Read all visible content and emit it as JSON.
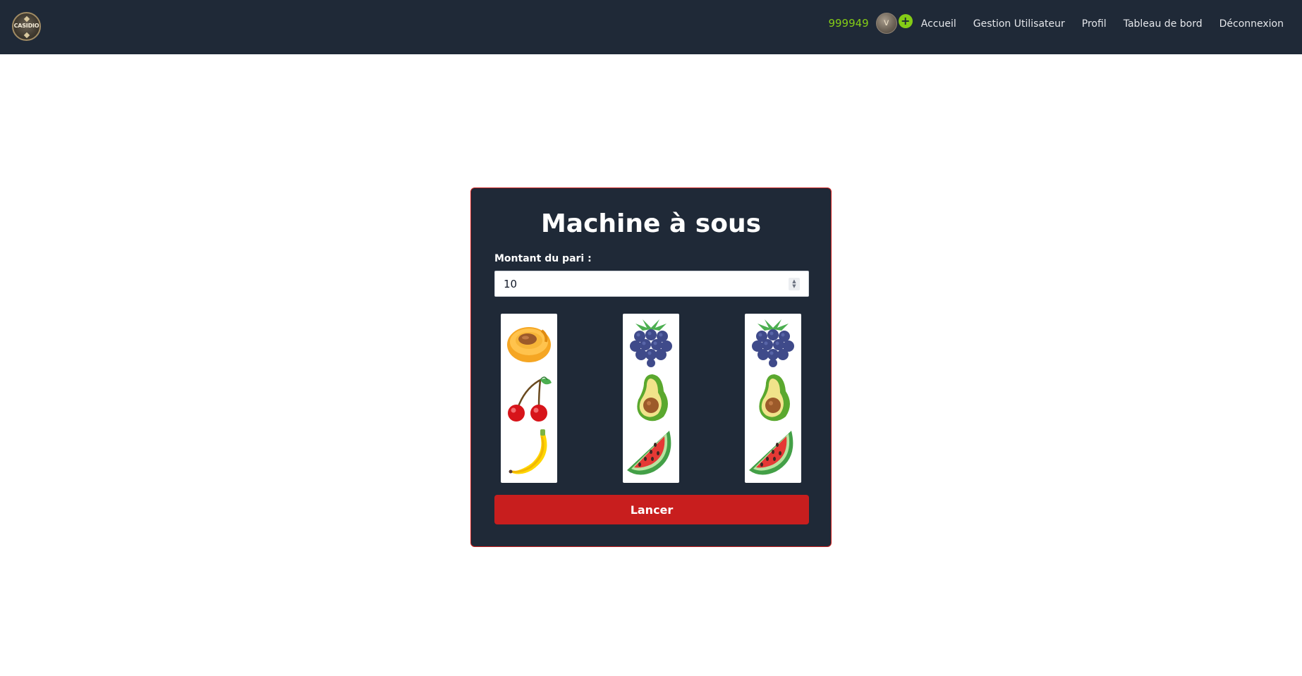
{
  "navbar": {
    "logo_text": "CASIDIO",
    "balance": "999949",
    "coin_icon": "v",
    "add_label": "+",
    "links": [
      "Accueil",
      "Gestion Utilisateur",
      "Profil",
      "Tableau de bord",
      "Déconnexion"
    ]
  },
  "slot": {
    "title": "Machine à sous",
    "bet_label": "Montant du pari :",
    "bet_value": "10",
    "spin_label": "Lancer",
    "reels": [
      [
        "apricot-icon",
        "cherry-icon",
        "banana-icon"
      ],
      [
        "blackberry-icon",
        "avocado-icon",
        "watermelon-icon"
      ],
      [
        "blackberry-icon",
        "avocado-icon",
        "watermelon-icon"
      ]
    ]
  },
  "colors": {
    "navbar_bg": "#1f2937",
    "balance": "#84cc16",
    "accent_red": "#c81e1e"
  }
}
